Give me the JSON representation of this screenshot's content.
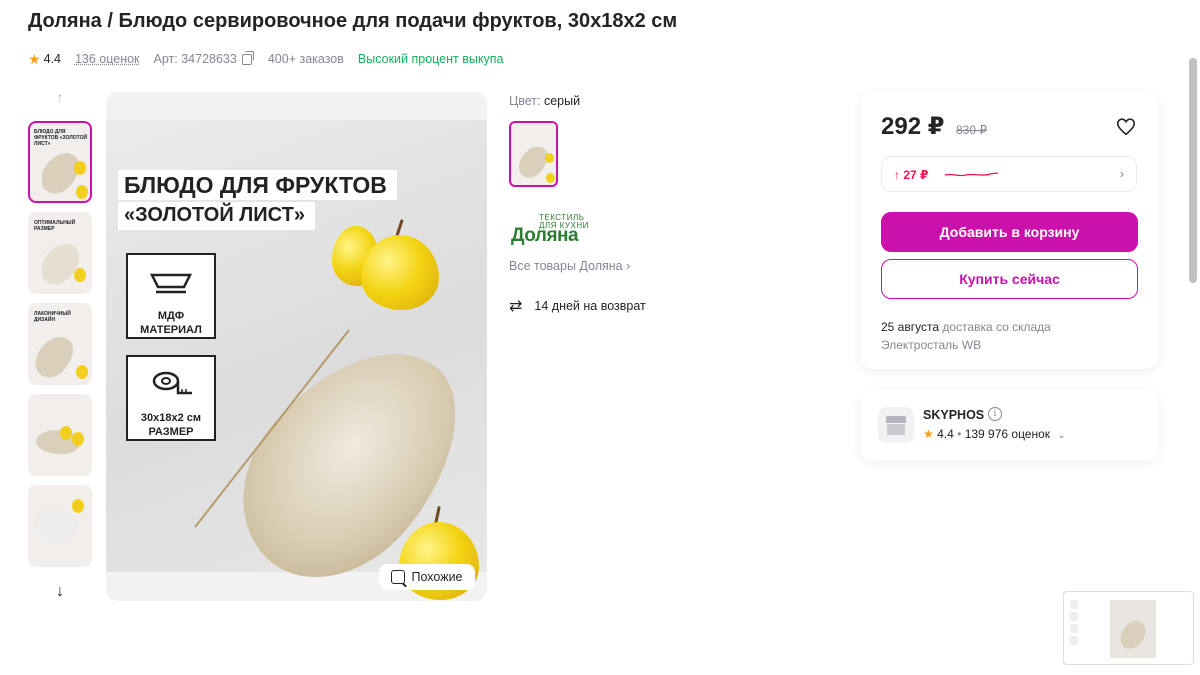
{
  "product": {
    "title": "Доляна / Блюдо сервировочное для подачи фруктов, 30х18х2 см",
    "rating": "4.4",
    "reviews": "136 оценок",
    "article": "Арт: 34728633",
    "orders": "400+ заказов",
    "buyout": "Высокий процент выкупа"
  },
  "gallery": {
    "headline_line1": "БЛЮДО ДЛЯ ФРУКТОВ",
    "headline_line2": "«ЗОЛОТОЙ ЛИСТ»",
    "badge1": "МДФ МАТЕРИАЛ",
    "badge2": "30х18х2 см РАЗМЕР",
    "similar_label": "Похожие",
    "thumbs": [
      "БЛЮДО ДЛЯ ФРУКТОВ «ЗОЛОТОЙ ЛИСТ»",
      "ОПТИМАЛЬНЫЙ РАЗМЕР",
      "ЛАКОНИЧНЫЙ ДИЗАЙН",
      "",
      ""
    ]
  },
  "variant": {
    "color_label": "Цвет:",
    "color_value": "серый"
  },
  "brand": {
    "logo_small": "ТЕКСТИЛЬ ДЛЯ КУХНИ",
    "logo_big": "Доляна",
    "all_goods": "Все товары Доляна ›"
  },
  "return_policy": "14 дней на возврат",
  "pricing": {
    "price": "292 ₽",
    "old_price": "830 ₽",
    "delta": "↑ 27 ₽",
    "add_to_cart": "Добавить в корзину",
    "buy_now": "Купить сейчас",
    "delivery_date": "25 августа",
    "delivery_text": "доставка со склада",
    "warehouse": "Электросталь WB"
  },
  "seller": {
    "name": "SKYPHOS",
    "rating": "4.4",
    "reviews": "139 976 оценок"
  },
  "colors": {
    "accent": "#cb11ab",
    "price_up": "#f91155",
    "success": "#0fb15f",
    "star": "#ff9f0e"
  }
}
